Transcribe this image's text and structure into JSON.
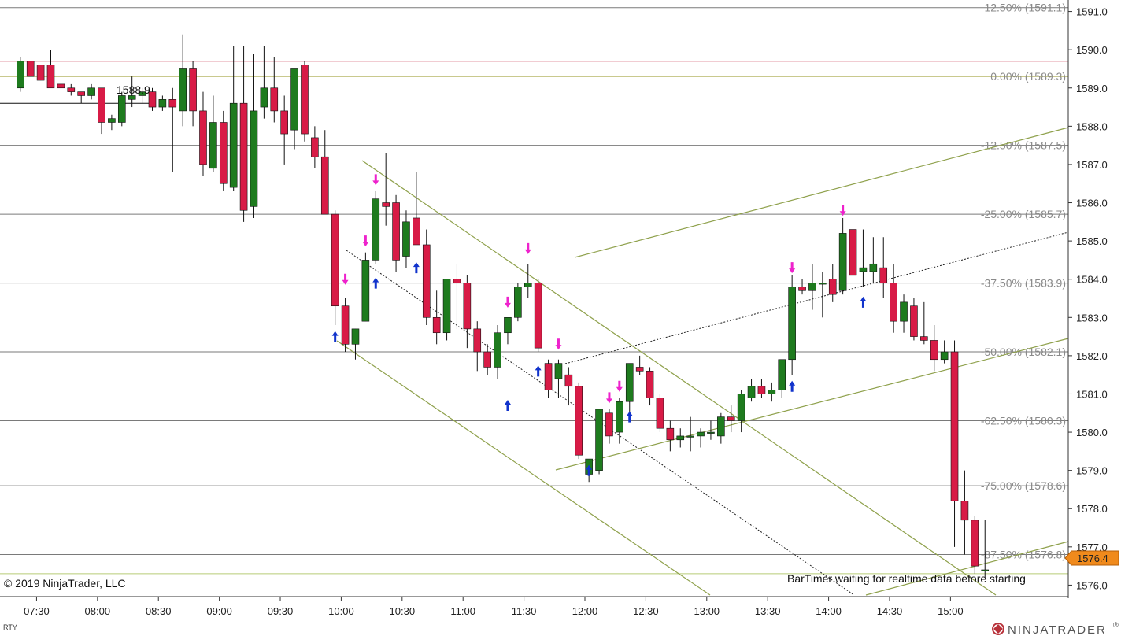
{
  "app": {
    "copyright": "© 2019 NinjaTrader, LLC",
    "brand": "NINJATRADER",
    "brand_mark": "®",
    "instrument": "RTY",
    "status_text": "BarTimer waiting for realtime data before starting",
    "price_marker": "1576.4",
    "overlay_label": "1588.9"
  },
  "colors": {
    "up": "#1e7b1e",
    "down": "#d81b46",
    "wick": "#111111",
    "fib_line": "#7a7a7a",
    "zero_line": "#a9a94a",
    "channel": "#8fa14c",
    "red_line": "#c8334a",
    "last_price": "#b8cc76",
    "marker_bg": "#f08a1c",
    "arrow_magenta": "#ee22cc",
    "arrow_blue": "#1133cc"
  },
  "chart_data": {
    "type": "candlestick",
    "xlim": [
      "07:12",
      "15:58"
    ],
    "ylim": [
      1575.7,
      1591.3
    ],
    "y_ticks": [
      1591.0,
      1590.0,
      1589.0,
      1588.0,
      1587.0,
      1586.0,
      1585.0,
      1584.0,
      1583.0,
      1582.0,
      1581.0,
      1580.0,
      1579.0,
      1578.0,
      1577.0,
      1576.0
    ],
    "x_ticks": [
      "07:30",
      "08:00",
      "08:30",
      "09:00",
      "09:30",
      "10:00",
      "10:30",
      "11:00",
      "11:30",
      "12:00",
      "12:30",
      "13:00",
      "13:30",
      "14:00",
      "14:30",
      "15:00"
    ],
    "fib_levels": [
      {
        "label": "12.50% (1591.1)",
        "price": 1591.1
      },
      {
        "label": "0.00% (1589.3)",
        "price": 1589.3
      },
      {
        "label": "-12.50% (1587.5)",
        "price": 1587.5
      },
      {
        "label": "-25.00% (1585.7)",
        "price": 1585.7
      },
      {
        "label": "-37.50% (1583.9)",
        "price": 1583.9
      },
      {
        "label": "-50.00% (1582.1)",
        "price": 1582.1
      },
      {
        "label": "-62.50% (1580.3)",
        "price": 1580.3
      },
      {
        "label": "-75.00% (1578.6)",
        "price": 1578.6
      },
      {
        "label": "-87.50% (1576.8)",
        "price": 1576.8
      }
    ],
    "horizontal_lines": [
      {
        "name": "red-level",
        "price": 1589.7
      },
      {
        "name": "black-level",
        "price": 1588.6
      },
      {
        "name": "last-price",
        "price": 1576.3
      }
    ],
    "last_price": 1576.4,
    "candles": [
      {
        "t": "07:22",
        "o": 1589.0,
        "h": 1589.8,
        "l": 1588.9,
        "c": 1589.7
      },
      {
        "t": "07:27",
        "o": 1589.7,
        "h": 1589.7,
        "l": 1589.3,
        "c": 1589.3
      },
      {
        "t": "07:32",
        "o": 1589.6,
        "h": 1589.6,
        "l": 1589.2,
        "c": 1589.2
      },
      {
        "t": "07:37",
        "o": 1589.6,
        "h": 1590.0,
        "l": 1589.0,
        "c": 1589.0
      },
      {
        "t": "07:42",
        "o": 1589.1,
        "h": 1589.1,
        "l": 1589.0,
        "c": 1589.0
      },
      {
        "t": "07:47",
        "o": 1589.0,
        "h": 1589.1,
        "l": 1588.8,
        "c": 1588.9
      },
      {
        "t": "07:52",
        "o": 1588.9,
        "h": 1588.9,
        "l": 1588.6,
        "c": 1588.8
      },
      {
        "t": "07:57",
        "o": 1588.8,
        "h": 1589.1,
        "l": 1588.7,
        "c": 1589.0
      },
      {
        "t": "08:02",
        "o": 1589.0,
        "h": 1589.0,
        "l": 1587.8,
        "c": 1588.1
      },
      {
        "t": "08:07",
        "o": 1588.1,
        "h": 1588.3,
        "l": 1587.9,
        "c": 1588.2
      },
      {
        "t": "08:12",
        "o": 1588.1,
        "h": 1588.9,
        "l": 1588.0,
        "c": 1588.8
      },
      {
        "t": "08:17",
        "o": 1588.7,
        "h": 1589.3,
        "l": 1588.5,
        "c": 1588.8
      },
      {
        "t": "08:22",
        "o": 1588.8,
        "h": 1589.0,
        "l": 1588.6,
        "c": 1588.9
      },
      {
        "t": "08:27",
        "o": 1588.9,
        "h": 1589.0,
        "l": 1588.4,
        "c": 1588.5
      },
      {
        "t": "08:32",
        "o": 1588.5,
        "h": 1588.8,
        "l": 1588.4,
        "c": 1588.7
      },
      {
        "t": "08:37",
        "o": 1588.7,
        "h": 1589.0,
        "l": 1586.8,
        "c": 1588.5
      },
      {
        "t": "08:42",
        "o": 1588.4,
        "h": 1590.4,
        "l": 1588.0,
        "c": 1589.5
      },
      {
        "t": "08:47",
        "o": 1589.5,
        "h": 1589.7,
        "l": 1588.0,
        "c": 1588.4
      },
      {
        "t": "08:52",
        "o": 1588.4,
        "h": 1588.9,
        "l": 1586.7,
        "c": 1587.0
      },
      {
        "t": "08:57",
        "o": 1586.9,
        "h": 1588.8,
        "l": 1586.8,
        "c": 1588.1
      },
      {
        "t": "09:02",
        "o": 1588.1,
        "h": 1588.4,
        "l": 1586.3,
        "c": 1586.5
      },
      {
        "t": "09:07",
        "o": 1586.4,
        "h": 1590.1,
        "l": 1586.3,
        "c": 1588.6
      },
      {
        "t": "09:12",
        "o": 1588.6,
        "h": 1590.1,
        "l": 1585.5,
        "c": 1585.8
      },
      {
        "t": "09:17",
        "o": 1585.9,
        "h": 1589.9,
        "l": 1585.6,
        "c": 1588.4
      },
      {
        "t": "09:22",
        "o": 1588.5,
        "h": 1590.1,
        "l": 1588.2,
        "c": 1589.0
      },
      {
        "t": "09:27",
        "o": 1589.0,
        "h": 1589.8,
        "l": 1588.1,
        "c": 1588.4
      },
      {
        "t": "09:32",
        "o": 1588.4,
        "h": 1588.8,
        "l": 1587.0,
        "c": 1587.8
      },
      {
        "t": "09:37",
        "o": 1587.9,
        "h": 1589.5,
        "l": 1587.4,
        "c": 1589.5
      },
      {
        "t": "09:42",
        "o": 1589.6,
        "h": 1589.7,
        "l": 1587.6,
        "c": 1587.8
      },
      {
        "t": "09:47",
        "o": 1587.7,
        "h": 1588.0,
        "l": 1586.9,
        "c": 1587.2
      },
      {
        "t": "09:52",
        "o": 1587.2,
        "h": 1587.9,
        "l": 1586.1,
        "c": 1585.7
      },
      {
        "t": "09:57",
        "o": 1585.7,
        "h": 1585.8,
        "l": 1582.8,
        "c": 1583.3
      },
      {
        "t": "10:02",
        "o": 1583.3,
        "h": 1583.5,
        "l": 1582.1,
        "c": 1582.3
      },
      {
        "t": "10:07",
        "o": 1582.3,
        "h": 1582.7,
        "l": 1581.9,
        "c": 1582.7
      },
      {
        "t": "10:12",
        "o": 1582.9,
        "h": 1584.7,
        "l": 1582.9,
        "c": 1584.5
      },
      {
        "t": "10:17",
        "o": 1584.5,
        "h": 1586.3,
        "l": 1584.4,
        "c": 1586.1
      },
      {
        "t": "10:22",
        "o": 1586.0,
        "h": 1587.3,
        "l": 1585.4,
        "c": 1585.9
      },
      {
        "t": "10:27",
        "o": 1586.0,
        "h": 1586.2,
        "l": 1584.2,
        "c": 1584.5
      },
      {
        "t": "10:32",
        "o": 1584.6,
        "h": 1585.8,
        "l": 1584.3,
        "c": 1585.5
      },
      {
        "t": "10:37",
        "o": 1585.6,
        "h": 1586.8,
        "l": 1585.0,
        "c": 1584.9
      },
      {
        "t": "10:42",
        "o": 1584.9,
        "h": 1585.3,
        "l": 1582.8,
        "c": 1583.0
      },
      {
        "t": "10:47",
        "o": 1583.0,
        "h": 1583.7,
        "l": 1582.3,
        "c": 1582.6
      },
      {
        "t": "10:52",
        "o": 1582.6,
        "h": 1584.0,
        "l": 1582.4,
        "c": 1584.0
      },
      {
        "t": "10:57",
        "o": 1584.0,
        "h": 1584.4,
        "l": 1582.7,
        "c": 1583.9
      },
      {
        "t": "11:02",
        "o": 1583.9,
        "h": 1584.1,
        "l": 1582.2,
        "c": 1582.7
      },
      {
        "t": "11:07",
        "o": 1582.7,
        "h": 1582.9,
        "l": 1581.6,
        "c": 1582.1
      },
      {
        "t": "11:12",
        "o": 1582.1,
        "h": 1582.3,
        "l": 1581.5,
        "c": 1581.7
      },
      {
        "t": "11:17",
        "o": 1581.7,
        "h": 1582.8,
        "l": 1581.4,
        "c": 1582.6
      },
      {
        "t": "11:22",
        "o": 1582.6,
        "h": 1583.0,
        "l": 1582.3,
        "c": 1583.0
      },
      {
        "t": "11:27",
        "o": 1583.0,
        "h": 1583.9,
        "l": 1582.9,
        "c": 1583.8
      },
      {
        "t": "11:32",
        "o": 1583.8,
        "h": 1584.4,
        "l": 1583.5,
        "c": 1583.9
      },
      {
        "t": "11:37",
        "o": 1583.9,
        "h": 1584.0,
        "l": 1582.1,
        "c": 1582.2
      },
      {
        "t": "11:42",
        "o": 1581.8,
        "h": 1581.9,
        "l": 1580.9,
        "c": 1581.1
      },
      {
        "t": "11:47",
        "o": 1581.4,
        "h": 1581.9,
        "l": 1580.9,
        "c": 1581.8
      },
      {
        "t": "11:52",
        "o": 1581.5,
        "h": 1581.7,
        "l": 1580.7,
        "c": 1581.2
      },
      {
        "t": "11:57",
        "o": 1581.2,
        "h": 1581.3,
        "l": 1579.3,
        "c": 1579.4
      },
      {
        "t": "12:02",
        "o": 1578.9,
        "h": 1579.0,
        "l": 1578.7,
        "c": 1579.3
      },
      {
        "t": "12:07",
        "o": 1579.0,
        "h": 1580.6,
        "l": 1578.9,
        "c": 1580.6
      },
      {
        "t": "12:12",
        "o": 1580.5,
        "h": 1580.6,
        "l": 1579.7,
        "c": 1579.9
      },
      {
        "t": "12:17",
        "o": 1580.0,
        "h": 1580.9,
        "l": 1579.7,
        "c": 1580.8
      },
      {
        "t": "12:22",
        "o": 1580.8,
        "h": 1581.8,
        "l": 1580.3,
        "c": 1581.8
      },
      {
        "t": "12:27",
        "o": 1581.7,
        "h": 1582.0,
        "l": 1581.5,
        "c": 1581.6
      },
      {
        "t": "12:32",
        "o": 1581.6,
        "h": 1581.7,
        "l": 1580.7,
        "c": 1580.9
      },
      {
        "t": "12:37",
        "o": 1580.9,
        "h": 1581.0,
        "l": 1580.0,
        "c": 1580.1
      },
      {
        "t": "12:42",
        "o": 1580.1,
        "h": 1580.3,
        "l": 1579.5,
        "c": 1579.8
      },
      {
        "t": "12:47",
        "o": 1579.8,
        "h": 1580.1,
        "l": 1579.6,
        "c": 1579.9
      },
      {
        "t": "12:52",
        "o": 1579.9,
        "h": 1580.4,
        "l": 1579.5,
        "c": 1579.9
      },
      {
        "t": "12:57",
        "o": 1579.9,
        "h": 1580.1,
        "l": 1579.6,
        "c": 1580.0
      },
      {
        "t": "13:02",
        "o": 1580.0,
        "h": 1580.3,
        "l": 1579.8,
        "c": 1580.0
      },
      {
        "t": "13:07",
        "o": 1579.9,
        "h": 1580.5,
        "l": 1579.7,
        "c": 1580.4
      },
      {
        "t": "13:12",
        "o": 1580.4,
        "h": 1580.7,
        "l": 1580.0,
        "c": 1580.3
      },
      {
        "t": "13:17",
        "o": 1580.3,
        "h": 1581.1,
        "l": 1580.0,
        "c": 1581.0
      },
      {
        "t": "13:22",
        "o": 1580.9,
        "h": 1581.4,
        "l": 1580.8,
        "c": 1581.2
      },
      {
        "t": "13:27",
        "o": 1581.2,
        "h": 1581.4,
        "l": 1580.9,
        "c": 1581.0
      },
      {
        "t": "13:32",
        "o": 1581.0,
        "h": 1581.3,
        "l": 1580.8,
        "c": 1581.1
      },
      {
        "t": "13:37",
        "o": 1581.1,
        "h": 1581.6,
        "l": 1580.9,
        "c": 1581.9
      },
      {
        "t": "13:42",
        "o": 1581.9,
        "h": 1584.1,
        "l": 1581.5,
        "c": 1583.8
      },
      {
        "t": "13:47",
        "o": 1583.8,
        "h": 1584.0,
        "l": 1583.6,
        "c": 1583.7
      },
      {
        "t": "13:52",
        "o": 1583.7,
        "h": 1584.4,
        "l": 1583.2,
        "c": 1583.9
      },
      {
        "t": "13:57",
        "o": 1583.9,
        "h": 1584.2,
        "l": 1583.0,
        "c": 1583.9
      },
      {
        "t": "14:02",
        "o": 1584.0,
        "h": 1584.4,
        "l": 1583.4,
        "c": 1583.6
      },
      {
        "t": "14:07",
        "o": 1583.7,
        "h": 1585.6,
        "l": 1583.6,
        "c": 1585.2
      },
      {
        "t": "14:12",
        "o": 1585.3,
        "h": 1585.3,
        "l": 1584.1,
        "c": 1584.1
      },
      {
        "t": "14:17",
        "o": 1584.2,
        "h": 1585.3,
        "l": 1583.8,
        "c": 1584.3
      },
      {
        "t": "14:22",
        "o": 1584.2,
        "h": 1585.1,
        "l": 1583.9,
        "c": 1584.4
      },
      {
        "t": "14:27",
        "o": 1584.3,
        "h": 1585.1,
        "l": 1583.5,
        "c": 1583.9
      },
      {
        "t": "14:32",
        "o": 1583.9,
        "h": 1584.4,
        "l": 1582.6,
        "c": 1582.9
      },
      {
        "t": "14:37",
        "o": 1582.9,
        "h": 1583.6,
        "l": 1582.6,
        "c": 1583.4
      },
      {
        "t": "14:42",
        "o": 1583.3,
        "h": 1583.5,
        "l": 1582.4,
        "c": 1582.5
      },
      {
        "t": "14:47",
        "o": 1582.5,
        "h": 1583.4,
        "l": 1582.3,
        "c": 1582.4
      },
      {
        "t": "14:52",
        "o": 1582.4,
        "h": 1582.8,
        "l": 1581.6,
        "c": 1581.9
      },
      {
        "t": "14:57",
        "o": 1581.9,
        "h": 1582.4,
        "l": 1581.8,
        "c": 1582.1
      },
      {
        "t": "15:02",
        "o": 1582.1,
        "h": 1582.4,
        "l": 1577.0,
        "c": 1578.2
      },
      {
        "t": "15:07",
        "o": 1578.2,
        "h": 1579.0,
        "l": 1576.8,
        "c": 1577.7
      },
      {
        "t": "15:12",
        "o": 1577.7,
        "h": 1577.8,
        "l": 1576.3,
        "c": 1576.5
      },
      {
        "t": "15:17",
        "o": 1576.4,
        "h": 1577.7,
        "l": 1576.2,
        "c": 1576.4
      }
    ],
    "signals": [
      {
        "t": "09:57",
        "dir": "up",
        "price": 1582.5
      },
      {
        "t": "10:02",
        "dir": "down",
        "price": 1584.0
      },
      {
        "t": "10:12",
        "dir": "down",
        "price": 1585.0
      },
      {
        "t": "10:17",
        "dir": "down",
        "price": 1586.6
      },
      {
        "t": "10:17",
        "dir": "up",
        "price": 1583.9
      },
      {
        "t": "10:37",
        "dir": "up",
        "price": 1584.3
      },
      {
        "t": "11:22",
        "dir": "down",
        "price": 1583.4
      },
      {
        "t": "11:22",
        "dir": "up",
        "price": 1580.7
      },
      {
        "t": "11:32",
        "dir": "down",
        "price": 1584.8
      },
      {
        "t": "11:37",
        "dir": "up",
        "price": 1581.6
      },
      {
        "t": "11:47",
        "dir": "down",
        "price": 1582.3
      },
      {
        "t": "12:02",
        "dir": "up",
        "price": 1579.0
      },
      {
        "t": "12:12",
        "dir": "down",
        "price": 1580.9
      },
      {
        "t": "12:17",
        "dir": "down",
        "price": 1581.2
      },
      {
        "t": "12:22",
        "dir": "up",
        "price": 1580.4
      },
      {
        "t": "13:42",
        "dir": "down",
        "price": 1584.3
      },
      {
        "t": "13:42",
        "dir": "up",
        "price": 1581.2
      },
      {
        "t": "14:07",
        "dir": "down",
        "price": 1585.8
      },
      {
        "t": "14:17",
        "dir": "up",
        "price": 1583.4
      }
    ]
  }
}
